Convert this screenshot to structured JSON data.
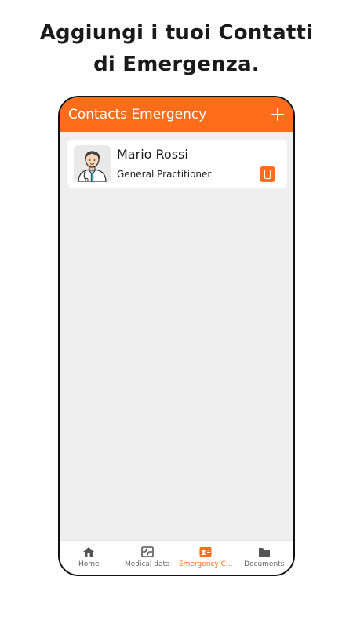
{
  "promo": {
    "title_line1": "Aggiungi i tuoi Contatti",
    "title_line2": "di Emergenza."
  },
  "app_bar": {
    "title": "Contacts Emergency",
    "add_icon": "plus-icon"
  },
  "contacts": [
    {
      "name": "Mario Rossi",
      "role": "General Practitioner",
      "avatar": "doctor-avatar",
      "action_icon": "mobile-phone-icon"
    }
  ],
  "bottom_nav": {
    "items": [
      {
        "label": "Home",
        "icon": "home-icon",
        "active": false
      },
      {
        "label": "Medical data",
        "icon": "heartbeat-icon",
        "active": false
      },
      {
        "label": "Emergency C...",
        "icon": "contact-card-icon",
        "active": true
      },
      {
        "label": "Documents",
        "icon": "folder-icon",
        "active": false
      }
    ]
  },
  "colors": {
    "accent": "#ff6d1a",
    "background": "#efefef",
    "nav_inactive": "#666666"
  }
}
